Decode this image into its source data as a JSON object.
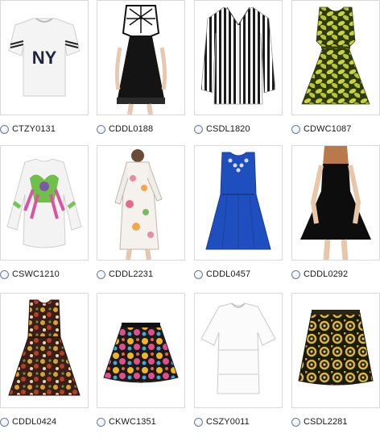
{
  "products": [
    {
      "code": "CTZY0131",
      "image": "white-ny-tshirt"
    },
    {
      "code": "CDDL0188",
      "image": "black-cutout-dress"
    },
    {
      "code": "CSDL1820",
      "image": "black-white-striped-blouse"
    },
    {
      "code": "CDWC1087",
      "image": "yellow-leaf-print-dress"
    },
    {
      "code": "CSWC1210",
      "image": "tropical-print-sweatshirt"
    },
    {
      "code": "CDDL2231",
      "image": "white-floral-lace-dress"
    },
    {
      "code": "CDDL0457",
      "image": "blue-embellished-dress"
    },
    {
      "code": "CDDL0292",
      "image": "black-skater-dress"
    },
    {
      "code": "CDDL0424",
      "image": "floral-print-skater-dress"
    },
    {
      "code": "CKWC1351",
      "image": "floral-print-skirt"
    },
    {
      "code": "CSZY0011",
      "image": "white-sheer-top"
    },
    {
      "code": "CSDL2281",
      "image": "yellow-baroque-skirt"
    }
  ]
}
